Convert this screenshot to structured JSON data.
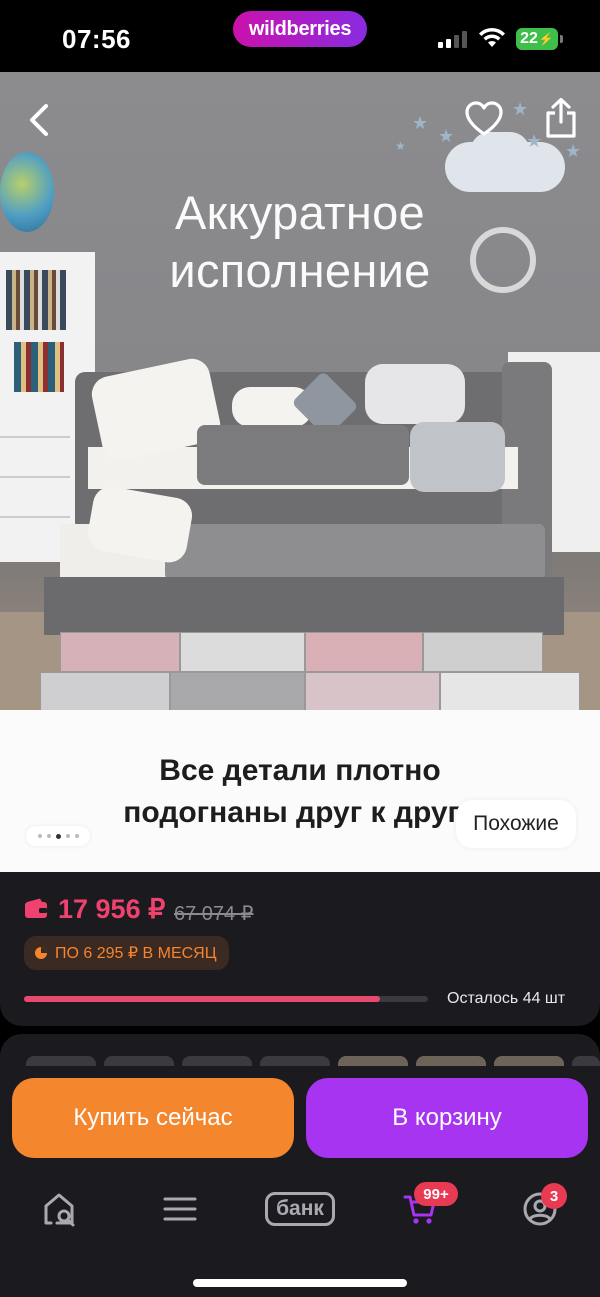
{
  "status_bar": {
    "time": "07:56",
    "brand": "wildberries",
    "battery": "22"
  },
  "hero": {
    "title_line1": "Аккуратное",
    "title_line2": "исполнение"
  },
  "caption": {
    "line1": "Все детали плотно",
    "line2": "подогнаны друг к другу"
  },
  "gallery": {
    "similar_label": "Похожие",
    "dot_count": 5,
    "active_dot": 2
  },
  "price": {
    "current": "17 956 ₽",
    "old": "67 074 ₽",
    "installment": "ПО 6 295 ₽ В МЕСЯЦ",
    "stock_label": "Осталось 44 шт",
    "stock_progress": 0.88
  },
  "actions": {
    "buy_now": "Купить сейчас",
    "add_to_cart": "В корзину"
  },
  "tabbar": {
    "bank_label": "банк",
    "cart_badge": "99+",
    "profile_badge": "3"
  },
  "colors": {
    "brand_gradient_start": "#cb11ab",
    "brand_gradient_end": "#8a2be2",
    "price": "#f0426f",
    "buy_button": "#f4862e",
    "cart_button": "#a734f1",
    "badge": "#e83a52"
  }
}
